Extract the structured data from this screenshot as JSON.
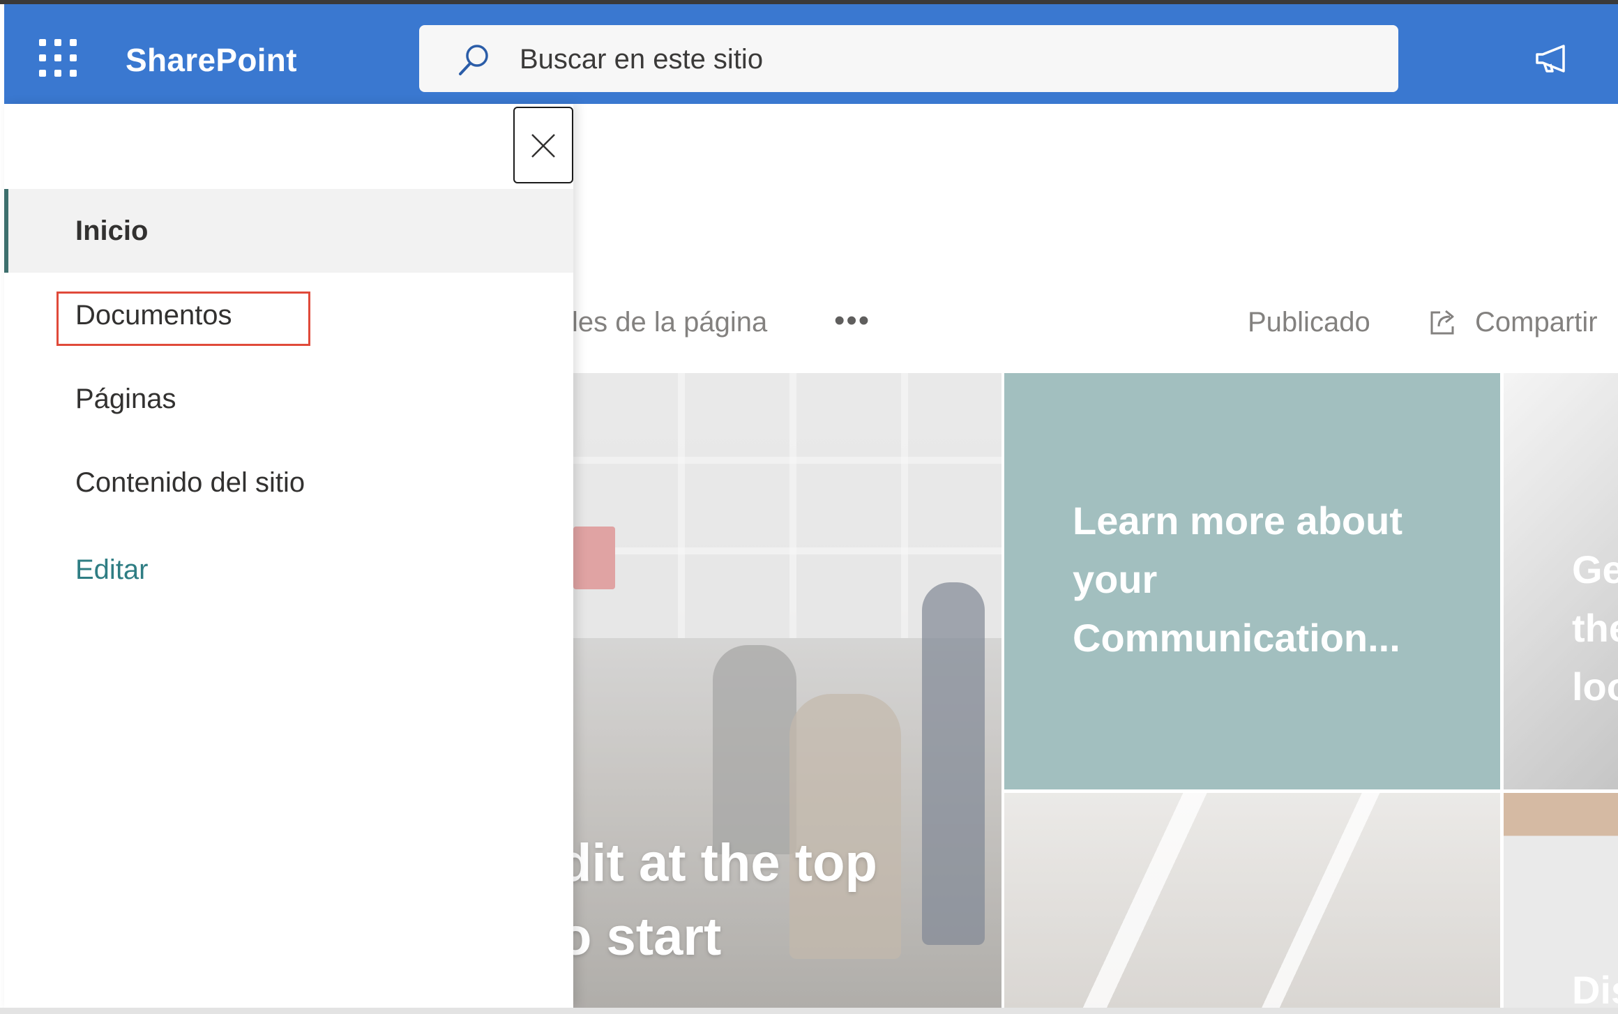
{
  "suite_bar": {
    "app_name": "SharePoint",
    "search_placeholder": "Buscar en este sitio",
    "accent_color": "#3a78d0"
  },
  "command_bar": {
    "page_details_partial": "les de la página",
    "more_label": "•••",
    "published_label": "Publicado",
    "share_label": "Compartir"
  },
  "hero": {
    "main_tile_text_line1": "dit at the top",
    "main_tile_text_line2": "o start",
    "teal_tile_title": "Learn more about your Communication...",
    "right_tile_title_partial_1": "Ge",
    "right_tile_title_partial_2": "the",
    "right_tile_title_partial_3": "loo",
    "right_bottom_partial": "Dis",
    "teal_color": "#88aeae"
  },
  "nav": {
    "items": [
      {
        "label": "Inicio",
        "selected": true
      },
      {
        "label": "Documentos",
        "selected": false,
        "highlighted": true
      },
      {
        "label": "Páginas",
        "selected": false
      },
      {
        "label": "Contenido del sitio",
        "selected": false
      }
    ],
    "edit_label": "Editar",
    "highlight_color": "#e04a3a",
    "selected_indicator_color": "#3d6f6d"
  },
  "icons": {
    "app_launcher": "waffle-icon",
    "search": "search-icon",
    "feedback": "megaphone-icon",
    "close": "close-icon",
    "share": "share-icon"
  }
}
